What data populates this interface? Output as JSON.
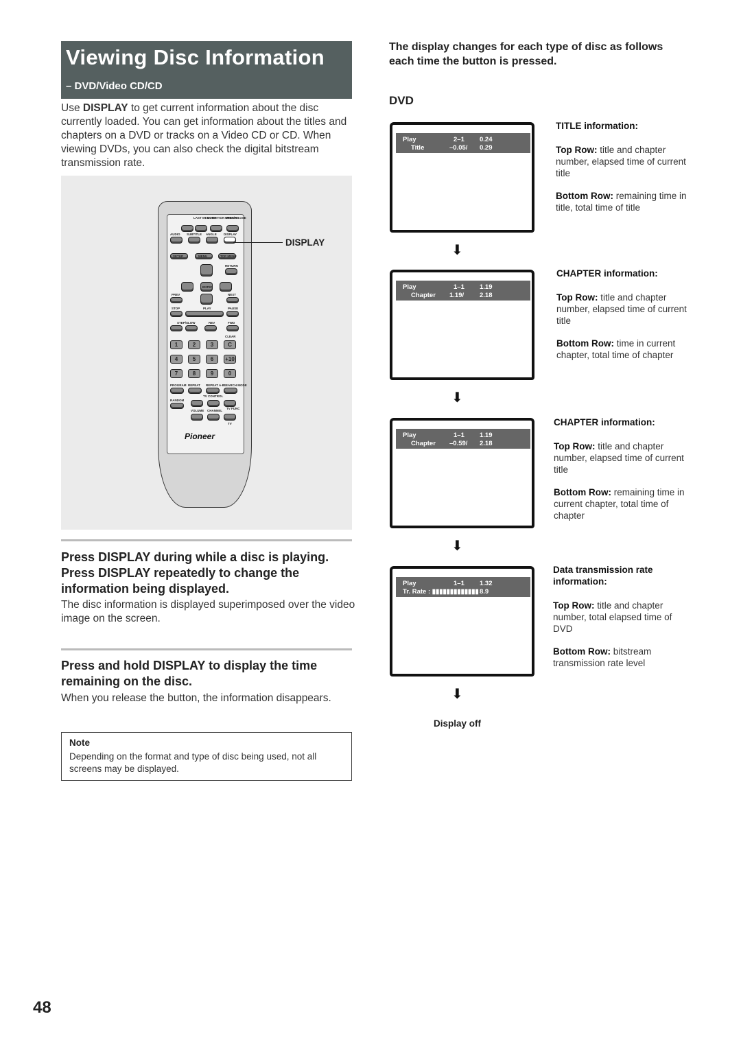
{
  "header": {
    "title": "Viewing Disc Information",
    "subtitle": "– DVD/Video CD/CD"
  },
  "intro": {
    "pre": "Use ",
    "bold": "DISPLAY",
    "post": " to get current information about the disc currently loaded. You can get information about the titles and chapters on a DVD or tracks on a Video CD or CD. When viewing DVDs, you can also check the digital bitstream transmission rate."
  },
  "figure": {
    "callout_label": "DISPLAY",
    "brand": "Pioneer",
    "top_labels": [
      "LAST MEMORY",
      "CONDITION MEMORY",
      "OPEN/ CLOSE",
      "AUDIO",
      "SUBTITLE",
      "ANGLE",
      "DISPLAY",
      "SETUP",
      "MENU",
      "TOP MENU",
      "RETURN",
      "ENTER",
      "PREV",
      "NEXT",
      "STOP",
      "PLAY",
      "PAUSE",
      "STEP/SLOW",
      "REV",
      "FWD",
      "CLEAR"
    ],
    "keys": [
      "1",
      "2",
      "3",
      "C",
      "4",
      "5",
      "6",
      "+10",
      "7",
      "8",
      "9",
      "0"
    ],
    "bottom_labels": [
      "PROGRAM",
      "REPEAT",
      "REPEAT A-B",
      "SEARCH MODE",
      "RANDOM",
      "TV CONTROL",
      "VOLUME",
      "CHANNEL",
      "TV FUNC",
      "TV"
    ]
  },
  "steps": [
    {
      "title": "Press DISPLAY during while a disc is playing. Press DISPLAY repeatedly to change the information being displayed.",
      "text": "The disc information is displayed superimposed over the video image on the screen."
    },
    {
      "title": "Press and hold DISPLAY to display the time remaining on the disc.",
      "text": "When you release the button, the information disappears."
    }
  ],
  "note": {
    "title": "Note",
    "text": "Depending on the format and type of disc being used, not all screens may be displayed."
  },
  "right": {
    "heading": "The display changes for each type of disc as follows each time the button is pressed.",
    "section": "DVD",
    "display_off": "Display off",
    "screens": [
      {
        "r1": [
          "Play",
          "2–1",
          "0.24"
        ],
        "r2": [
          "Title",
          "–0.05/",
          "0.29"
        ],
        "info_title": "TITLE information:",
        "top": "title and chapter number, elapsed time of current title",
        "bottom": "remaining time in title, total time of title"
      },
      {
        "r1": [
          "Play",
          "1–1",
          "1.19"
        ],
        "r2": [
          "Chapter",
          "1.19/",
          "2.18"
        ],
        "info_title": "CHAPTER information:",
        "top": "title and chapter number, elapsed time of current title",
        "bottom": "time in current chapter, total time of chapter"
      },
      {
        "r1": [
          "Play",
          "1–1",
          "1.19"
        ],
        "r2": [
          "Chapter",
          "–0.59/",
          "2.18"
        ],
        "info_title": "CHAPTER information:",
        "top": "title and chapter number, elapsed time of current title",
        "bottom": "remaining time in current chapter, total time of chapter"
      },
      {
        "r1": [
          "Play",
          "1–1",
          "1.32"
        ],
        "r2": [
          "Tr. Rate  : ▮▮▮▮▮▮▮▮▮▮▮▮▮",
          "",
          "8.9"
        ],
        "info_title": "Data transmission rate information:",
        "top": "title and chapter number, total elapsed time of DVD",
        "bottom": "bitstream transmission rate level"
      }
    ],
    "top_row_label": "Top Row:",
    "bottom_row_label": "Bottom Row:"
  },
  "page_number": "48"
}
